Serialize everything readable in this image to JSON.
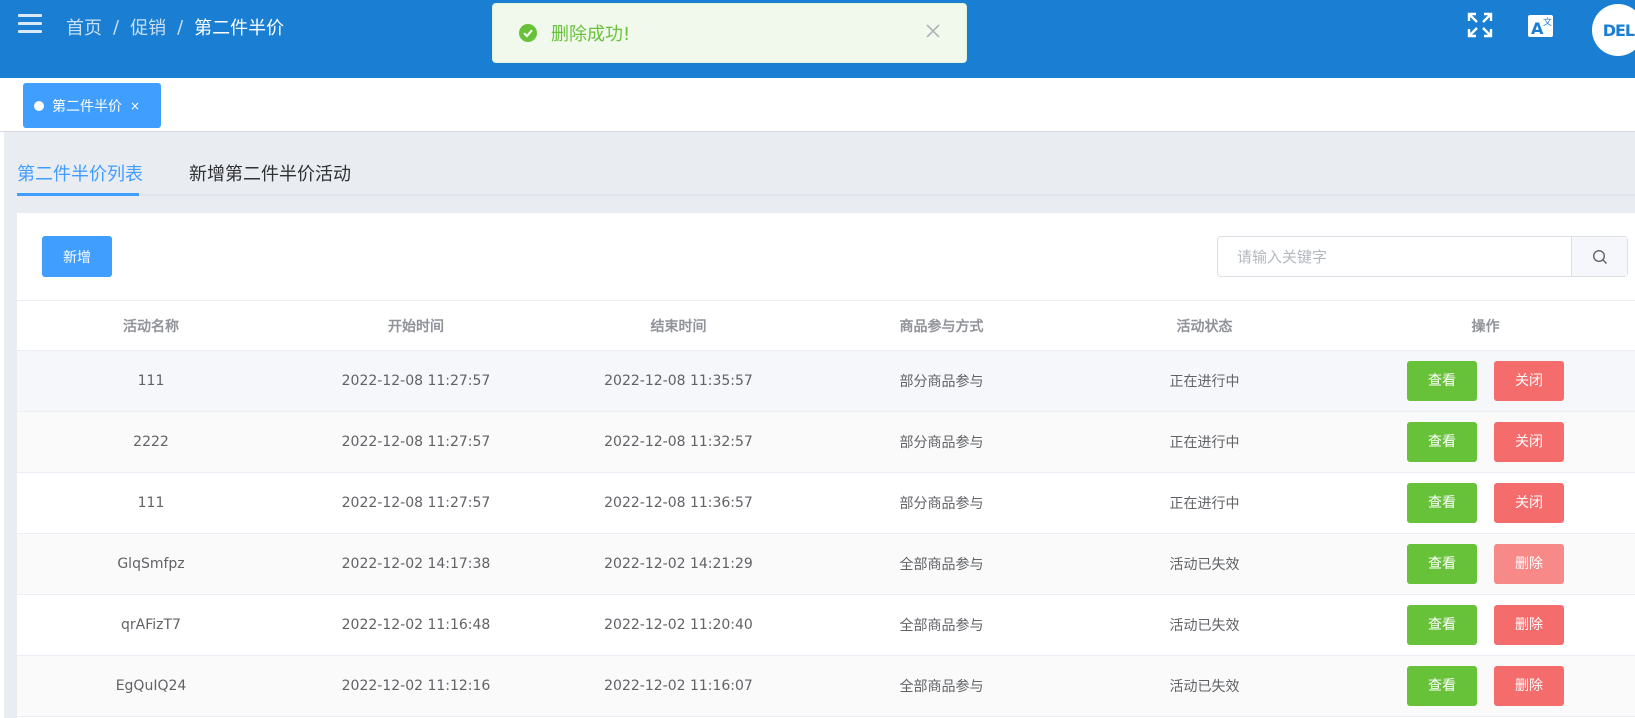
{
  "header": {
    "breadcrumb": [
      "首页",
      "促销",
      "第二件半价"
    ],
    "separator": "/",
    "logo_text": "DELL",
    "brand_color": "#1a7fd3"
  },
  "toast": {
    "message": "删除成功!",
    "icon": "check-circle-icon",
    "type": "success"
  },
  "tags": [
    {
      "label": "第二件半价",
      "close": "×"
    }
  ],
  "tabs": {
    "active": "第二件半价列表",
    "inactive": "新增第二件半价活动"
  },
  "toolbar": {
    "add_label": "新增",
    "search_placeholder": "请输入关键字"
  },
  "table": {
    "columns": [
      "活动名称",
      "开始时间",
      "结束时间",
      "商品参与方式",
      "活动状态",
      "操作"
    ],
    "rows": [
      {
        "name": "111",
        "start": "2022-12-08 11:27:57",
        "end": "2022-12-08 11:35:57",
        "mode": "部分商品参与",
        "status": "正在进行中",
        "view": "查看",
        "action": "关闭"
      },
      {
        "name": "2222",
        "start": "2022-12-08 11:27:57",
        "end": "2022-12-08 11:32:57",
        "mode": "部分商品参与",
        "status": "正在进行中",
        "view": "查看",
        "action": "关闭"
      },
      {
        "name": "111",
        "start": "2022-12-08 11:27:57",
        "end": "2022-12-08 11:36:57",
        "mode": "部分商品参与",
        "status": "正在进行中",
        "view": "查看",
        "action": "关闭"
      },
      {
        "name": "GlqSmfpz",
        "start": "2022-12-02 14:17:38",
        "end": "2022-12-02 14:21:29",
        "mode": "全部商品参与",
        "status": "活动已失效",
        "view": "查看",
        "action": "删除"
      },
      {
        "name": "qrAFizT7",
        "start": "2022-12-02 11:16:48",
        "end": "2022-12-02 11:20:40",
        "mode": "全部商品参与",
        "status": "活动已失效",
        "view": "查看",
        "action": "删除"
      },
      {
        "name": "EgQuIQ24",
        "start": "2022-12-02 11:12:16",
        "end": "2022-12-02 11:16:07",
        "mode": "全部商品参与",
        "status": "活动已失效",
        "view": "查看",
        "action": "删除"
      }
    ]
  }
}
